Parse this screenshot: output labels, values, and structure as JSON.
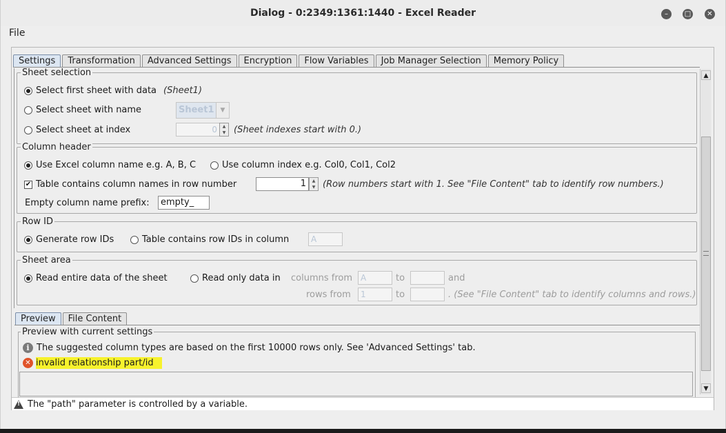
{
  "window": {
    "title": "Dialog - 0:2349:1361:1440 - Excel Reader"
  },
  "menu": {
    "file": "File"
  },
  "tabs": [
    "Settings",
    "Transformation",
    "Advanced Settings",
    "Encryption",
    "Flow Variables",
    "Job Manager Selection",
    "Memory Policy"
  ],
  "sheet_selection": {
    "title": "Sheet selection",
    "first_sheet_label": "Select first sheet with data",
    "first_sheet_hint": "(Sheet1)",
    "by_name_label": "Select sheet with name",
    "by_name_value": "Sheet1",
    "by_index_label": "Select sheet at index",
    "by_index_value": "0",
    "by_index_hint": "(Sheet indexes start with 0.)"
  },
  "column_header": {
    "title": "Column header",
    "excel_name_label": "Use Excel column name e.g. A, B, C",
    "col_index_label": "Use column index e.g. Col0, Col1, Col2",
    "row_number_label": "Table contains column names in row number",
    "row_number_value": "1",
    "row_number_hint": "(Row numbers start with 1. See \"File Content\" tab to identify row numbers.)",
    "prefix_label": "Empty column name prefix:",
    "prefix_value": "empty_"
  },
  "row_id": {
    "title": "Row ID",
    "generate_label": "Generate row IDs",
    "in_column_label": "Table contains row IDs in column",
    "column_value": "A"
  },
  "sheet_area": {
    "title": "Sheet area",
    "entire_label": "Read entire data of the sheet",
    "only_label": "Read only data in",
    "columns_from": "columns from",
    "col_from_value": "A",
    "to": "to",
    "and": "and",
    "rows_from": "rows from",
    "row_from_value": "1",
    "hint": ". (See \"File Content\" tab to identify columns and rows.)"
  },
  "preview_tabs": [
    "Preview",
    "File Content"
  ],
  "preview": {
    "title": "Preview with current settings",
    "info": "The suggested column types are based on the first 10000 rows only. See 'Advanced Settings' tab.",
    "error": "invalid relationship part/id"
  },
  "status": {
    "warning": "The \"path\" parameter is controlled by a variable."
  }
}
